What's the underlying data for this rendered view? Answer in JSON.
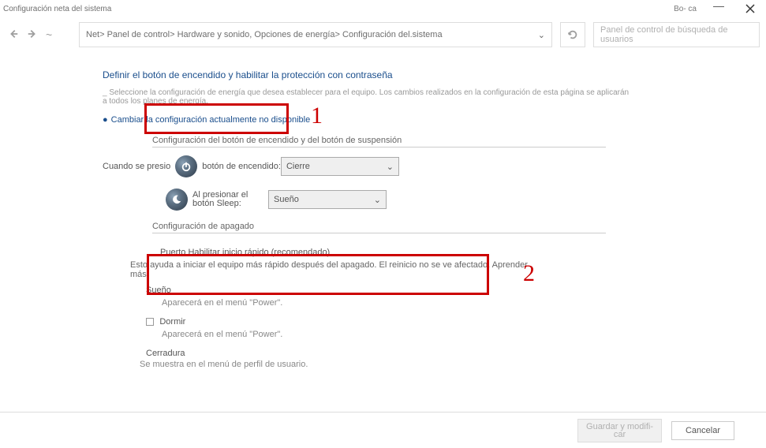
{
  "window": {
    "title": "Configuración neta del sistema",
    "boca": "Bo-\nca"
  },
  "breadcrumb": "Net> Panel de control> Hardware y sonido, Opciones de energía> Configuración del.sistema",
  "search_placeholder": "Panel de control de búsqueda de usuarios",
  "heading": "Definir el botón de encendido y habilitar la protección con contraseña",
  "subtext": "_ Seleccione la configuración de energía que desea establecer para el  equipo. Los cambios realizados en la configuración de esta página se aplicarán a todos los planes de energía.",
  "link_change": "Cambiar la configuración actualmente no disponible",
  "section_buttons": "Configuración del botón de encendido y del botón de suspensión",
  "power_label_pre": "Cuando se presio",
  "power_label_post": "botón de encendido:",
  "power_value": "Cierre",
  "sleep_label": "Al presionar el botón Sleep:",
  "sleep_value": "Sueño",
  "shutdown_title": "Configuración de apagado",
  "fast_label": "Puerto Habilitar inicio rápido (recomendado)",
  "fast_desc": "Esto ayuda a iniciar el equipo más rápido después del apagado. El reinicio no se ve afectado. Aprender más",
  "dream_label": "Sueño",
  "dream_sub": "Aparecerá en el menú \"Power\".",
  "sleep2_label": "Dormir",
  "sleep2_sub": "Aparecerá en el menú \"Power\".",
  "lock_label": "Cerradura",
  "lock_sub": "Se muestra en el menú de perfil de usuario.",
  "btn_save": "Guardar y modifi-\ncar",
  "btn_cancel": "Cancelar",
  "annot1": "1",
  "annot2": "2"
}
